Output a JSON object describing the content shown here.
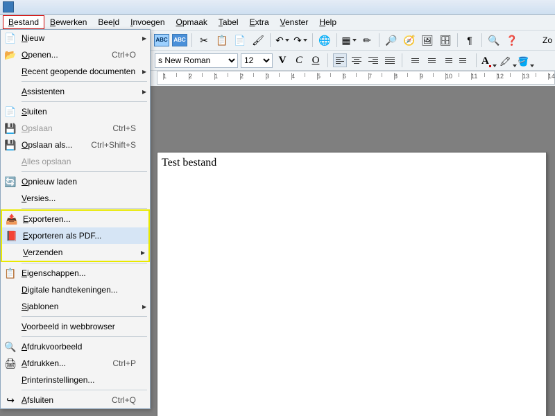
{
  "menubar": {
    "items": [
      {
        "label": "Bestand",
        "u": "B",
        "rest": "estand"
      },
      {
        "label": "Bewerken",
        "u": "B",
        "rest": "ewerken"
      },
      {
        "label": "Beeld",
        "u": "",
        "rest": "Beeld",
        "raw": "Bee",
        "after": "ld",
        "uidx": 3
      },
      {
        "label": "Invoegen",
        "u": "I",
        "rest": "nvoegen"
      },
      {
        "label": "Opmaak",
        "u": "O",
        "rest": "pmaak"
      },
      {
        "label": "Tabel",
        "u": "T",
        "rest": "abel"
      },
      {
        "label": "Extra",
        "u": "E",
        "rest": "xtra"
      },
      {
        "label": "Venster",
        "u": "V",
        "rest": "enster"
      },
      {
        "label": "Help",
        "u": "H",
        "rest": "elp"
      }
    ]
  },
  "file_menu": {
    "items": [
      {
        "icon": "📄",
        "label": "Nieuw",
        "shortcut": "",
        "arrow": true
      },
      {
        "icon": "📂",
        "label": "Openen...",
        "shortcut": "Ctrl+O",
        "arrow": false
      },
      {
        "icon": "",
        "label": "Recent geopende documenten",
        "shortcut": "",
        "arrow": true
      },
      {
        "sep": true
      },
      {
        "icon": "",
        "label": "Assistenten",
        "shortcut": "",
        "arrow": true
      },
      {
        "sep": true
      },
      {
        "icon": "📄",
        "label": "Sluiten",
        "shortcut": "",
        "arrow": false
      },
      {
        "icon": "💾",
        "label": "Opslaan",
        "shortcut": "Ctrl+S",
        "arrow": false,
        "disabled": true
      },
      {
        "icon": "💾",
        "label": "Opslaan als...",
        "shortcut": "Ctrl+Shift+S",
        "arrow": false
      },
      {
        "icon": "",
        "label": "Alles opslaan",
        "shortcut": "",
        "arrow": false,
        "disabled": true
      },
      {
        "sep": true
      },
      {
        "icon": "🔄",
        "label": "Opnieuw laden",
        "shortcut": "",
        "arrow": false
      },
      {
        "icon": "",
        "label": "Versies...",
        "shortcut": "",
        "arrow": false
      },
      {
        "sep": true
      },
      {
        "icon": "📤",
        "label": "Exporteren...",
        "shortcut": "",
        "arrow": false,
        "hl": true
      },
      {
        "icon": "📕",
        "label": "Exporteren als PDF...",
        "shortcut": "",
        "arrow": false,
        "hl": true,
        "hover": true
      },
      {
        "icon": "",
        "label": "Verzenden",
        "shortcut": "",
        "arrow": true,
        "hl": true
      },
      {
        "sep": true
      },
      {
        "icon": "📋",
        "label": "Eigenschappen...",
        "shortcut": "",
        "arrow": false
      },
      {
        "icon": "",
        "label": "Digitale handtekeningen...",
        "shortcut": "",
        "arrow": false
      },
      {
        "icon": "",
        "label": "Sjablonen",
        "shortcut": "",
        "arrow": true
      },
      {
        "sep": true
      },
      {
        "icon": "",
        "label": "Voorbeeld in webbrowser",
        "shortcut": "",
        "arrow": false
      },
      {
        "sep": true
      },
      {
        "icon": "🔍",
        "label": "Afdrukvoorbeeld",
        "shortcut": "",
        "arrow": false
      },
      {
        "icon": "🖨",
        "label": "Afdrukken...",
        "shortcut": "Ctrl+P",
        "arrow": false
      },
      {
        "icon": "",
        "label": "Printerinstellingen...",
        "shortcut": "",
        "arrow": false
      },
      {
        "sep": true
      },
      {
        "icon": "↪",
        "label": "Afsluiten",
        "shortcut": "Ctrl+Q",
        "arrow": false
      }
    ]
  },
  "toolbar2": {
    "font_name": "s New Roman",
    "font_size": "12",
    "bold": "V",
    "italic": "C",
    "underline": "O"
  },
  "toolbar1": {
    "abc1": "ABC",
    "abc2": "ABC"
  },
  "zoom": "Zo",
  "document": {
    "text": "Test bestand"
  },
  "ruler": {
    "marks": [
      "1",
      "2",
      "1",
      "2",
      "3",
      "4",
      "5",
      "6",
      "7",
      "8",
      "9",
      "10",
      "11",
      "12",
      "13",
      "14"
    ]
  },
  "colors": {
    "font": "#cc0000",
    "highlight": "#ffff00",
    "bg": "#ffff99"
  }
}
